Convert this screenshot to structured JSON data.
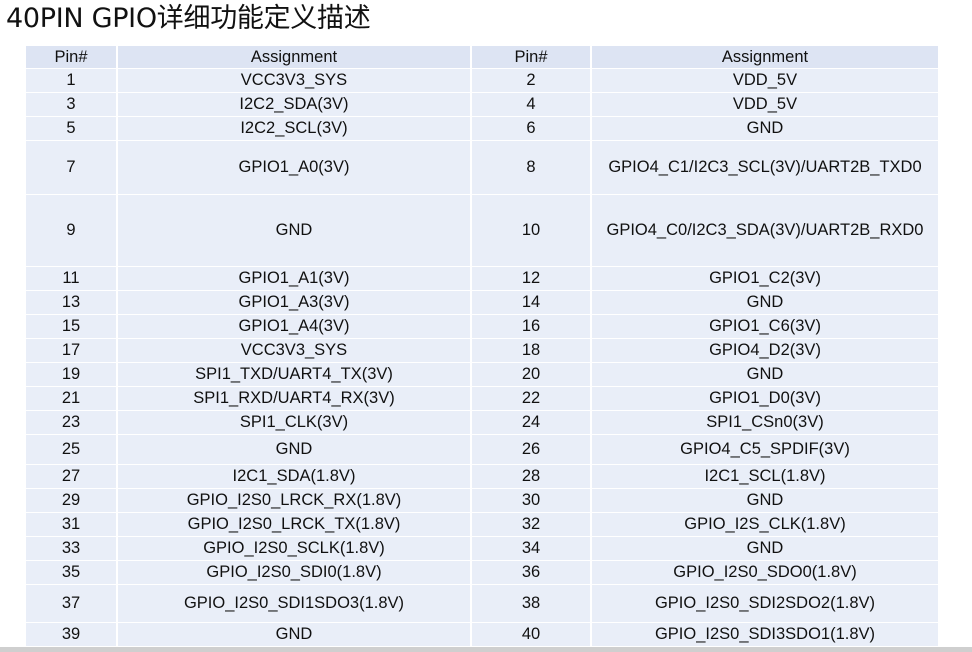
{
  "title": "40PIN GPIO详细功能定义描述",
  "headers": {
    "pin_left": "Pin#",
    "assign_left": "Assignment",
    "pin_right": "Pin#",
    "assign_right": "Assignment"
  },
  "rows": [
    {
      "p1": "1",
      "a1": "VCC3V3_SYS",
      "p2": "2",
      "a2": "VDD_5V"
    },
    {
      "p1": "3",
      "a1": "I2C2_SDA(3V)",
      "p2": "4",
      "a2": "VDD_5V"
    },
    {
      "p1": "5",
      "a1": "I2C2_SCL(3V)",
      "p2": "6",
      "a2": "GND"
    },
    {
      "p1": "7",
      "a1": "GPIO1_A0(3V)",
      "p2": "8",
      "a2": "GPIO4_C1/I2C3_SCL(3V)/UART2B_TXD0"
    },
    {
      "p1": "9",
      "a1": "GND",
      "p2": "10",
      "a2": "GPIO4_C0/I2C3_SDA(3V)/UART2B_RXD0"
    },
    {
      "p1": "11",
      "a1": "GPIO1_A1(3V)",
      "p2": "12",
      "a2": "GPIO1_C2(3V)"
    },
    {
      "p1": "13",
      "a1": "GPIO1_A3(3V)",
      "p2": "14",
      "a2": "GND"
    },
    {
      "p1": "15",
      "a1": "GPIO1_A4(3V)",
      "p2": "16",
      "a2": "GPIO1_C6(3V)"
    },
    {
      "p1": "17",
      "a1": "VCC3V3_SYS",
      "p2": "18",
      "a2": "GPIO4_D2(3V)"
    },
    {
      "p1": "19",
      "a1": "SPI1_TXD/UART4_TX(3V)",
      "p2": "20",
      "a2": "GND"
    },
    {
      "p1": "21",
      "a1": "SPI1_RXD/UART4_RX(3V)",
      "p2": "22",
      "a2": "GPIO1_D0(3V)"
    },
    {
      "p1": "23",
      "a1": "SPI1_CLK(3V)",
      "p2": "24",
      "a2": "SPI1_CSn0(3V)"
    },
    {
      "p1": "25",
      "a1": "GND",
      "p2": "26",
      "a2": "GPIO4_C5_SPDIF(3V)"
    },
    {
      "p1": "27",
      "a1": "I2C1_SDA(1.8V)",
      "p2": "28",
      "a2": "I2C1_SCL(1.8V)"
    },
    {
      "p1": "29",
      "a1": "GPIO_I2S0_LRCK_RX(1.8V)",
      "p2": "30",
      "a2": "GND"
    },
    {
      "p1": "31",
      "a1": "GPIO_I2S0_LRCK_TX(1.8V)",
      "p2": "32",
      "a2": "GPIO_I2S_CLK(1.8V)"
    },
    {
      "p1": "33",
      "a1": "GPIO_I2S0_SCLK(1.8V)",
      "p2": "34",
      "a2": "GND"
    },
    {
      "p1": "35",
      "a1": "GPIO_I2S0_SDI0(1.8V)",
      "p2": "36",
      "a2": "GPIO_I2S0_SDO0(1.8V)"
    },
    {
      "p1": "37",
      "a1": "GPIO_I2S0_SDI1SDO3(1.8V)",
      "p2": "38",
      "a2": "GPIO_I2S0_SDI2SDO2(1.8V)"
    },
    {
      "p1": "39",
      "a1": "GND",
      "p2": "40",
      "a2": "GPIO_I2S0_SDI3SDO1(1.8V)"
    }
  ]
}
